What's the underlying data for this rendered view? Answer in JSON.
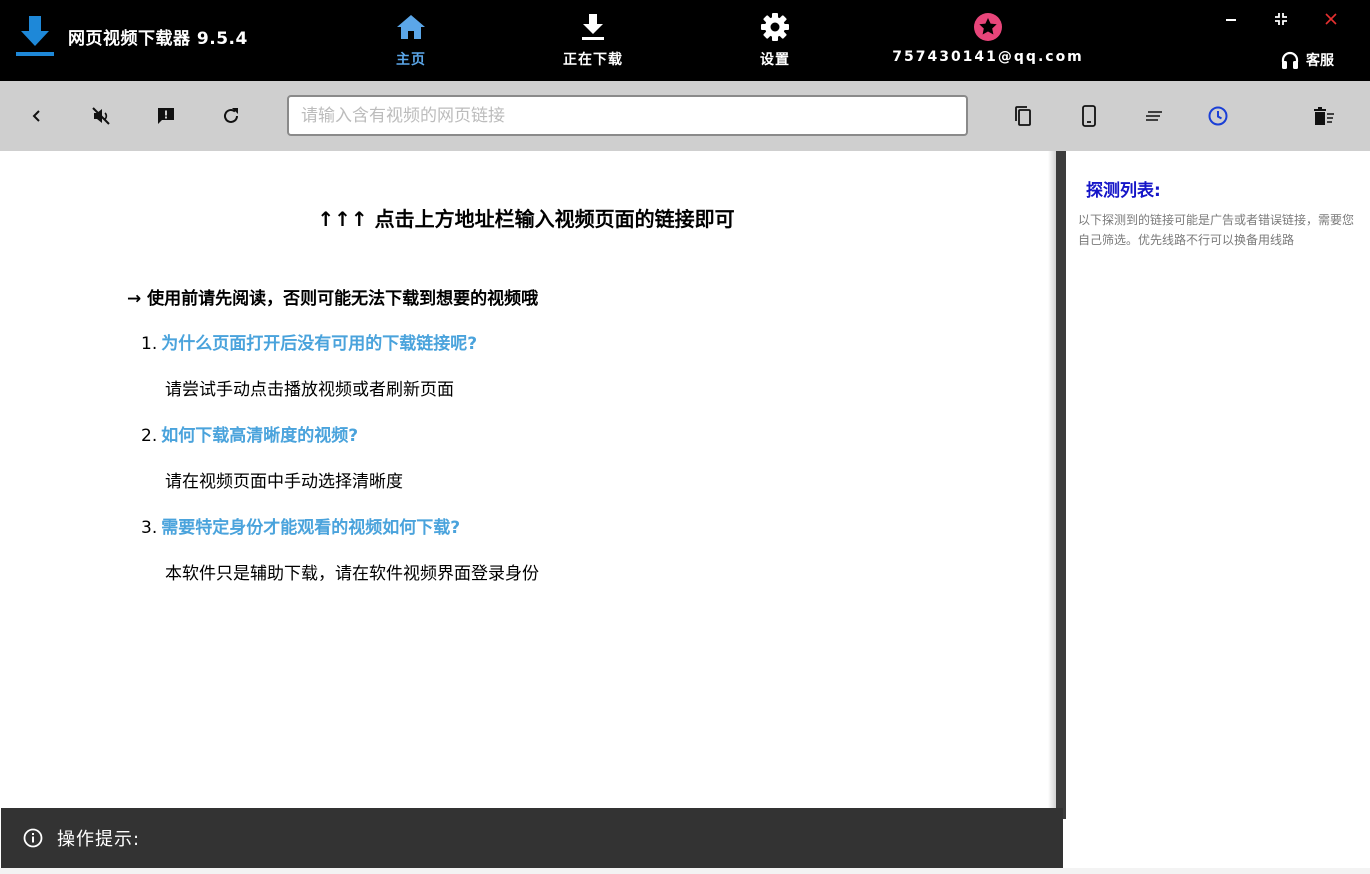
{
  "app": {
    "title": "网页视频下载器 9.5.4"
  },
  "nav": {
    "home": "主页",
    "downloading": "正在下载",
    "settings": "设置",
    "account": "757430141@qq.com"
  },
  "window": {
    "support": "客服"
  },
  "toolbar": {
    "url_placeholder": "请输入含有视频的网页链接",
    "url_value": ""
  },
  "main": {
    "headline": "↑↑↑ 点击上方地址栏输入视频页面的链接即可",
    "intro": "→ 使用前请先阅读，否则可能无法下载到想要的视频哦",
    "faq": [
      {
        "num": "1.",
        "question": "为什么页面打开后没有可用的下载链接呢?",
        "answer": "请尝试手动点击播放视频或者刷新页面"
      },
      {
        "num": "2.",
        "question": "如何下载高清晰度的视频?",
        "answer": "请在视频页面中手动选择清晰度"
      },
      {
        "num": "3.",
        "question": "需要特定身份才能观看的视频如何下载?",
        "answer": "本软件只是辅助下载，请在软件视频界面登录身份"
      }
    ]
  },
  "panel": {
    "title": "探测列表:",
    "desc": "以下探测到的链接可能是广告或者错误链接，需要您自己筛选。优先线路不行可以换备用线路"
  },
  "status": {
    "text": "操作提示:"
  },
  "colors": {
    "accent_blue": "#4aa3dc",
    "nav_active": "#5ba6e8",
    "panel_title": "#1515c8",
    "account_badge": "#e8457a",
    "active_tool": "#1a3fd6"
  },
  "icons": {
    "brand": "download-logo-icon",
    "home": "home-icon",
    "downloading": "download-icon",
    "settings": "gear-icon",
    "account": "star-badge-icon",
    "minimize": "minimize-icon",
    "fullscreen": "fullscreen-icon",
    "close": "close-icon",
    "support": "headset-icon",
    "back": "chevron-left-icon",
    "mute": "mute-icon",
    "feedback": "feedback-icon",
    "refresh": "refresh-icon",
    "copy": "copy-icon",
    "mobile": "mobile-icon",
    "list": "list-icon",
    "history": "clock-icon",
    "clear": "trash-icon",
    "info": "info-icon"
  }
}
